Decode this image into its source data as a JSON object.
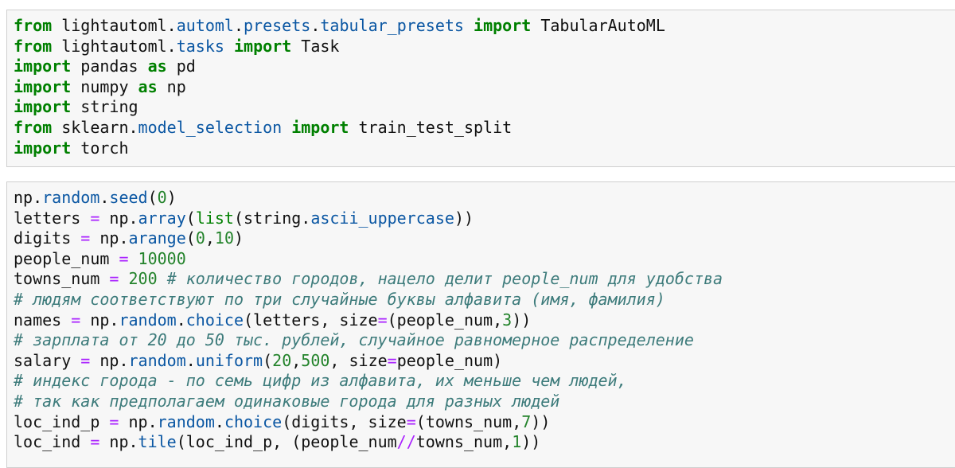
{
  "cells": [
    {
      "lines": [
        [
          [
            "kw",
            "from"
          ],
          [
            "plain",
            " lightautoml."
          ],
          [
            "attr",
            "automl"
          ],
          [
            "plain",
            "."
          ],
          [
            "attr",
            "presets"
          ],
          [
            "plain",
            "."
          ],
          [
            "attr",
            "tabular_presets"
          ],
          [
            "plain",
            " "
          ],
          [
            "kw",
            "import"
          ],
          [
            "plain",
            " TabularAutoML"
          ]
        ],
        [
          [
            "kw",
            "from"
          ],
          [
            "plain",
            " lightautoml."
          ],
          [
            "attr",
            "tasks"
          ],
          [
            "plain",
            " "
          ],
          [
            "kw",
            "import"
          ],
          [
            "plain",
            " Task"
          ]
        ],
        [
          [
            "kw",
            "import"
          ],
          [
            "plain",
            " pandas "
          ],
          [
            "kw",
            "as"
          ],
          [
            "plain",
            " pd"
          ]
        ],
        [
          [
            "kw",
            "import"
          ],
          [
            "plain",
            " numpy "
          ],
          [
            "kw",
            "as"
          ],
          [
            "plain",
            " np"
          ]
        ],
        [
          [
            "kw",
            "import"
          ],
          [
            "plain",
            " string"
          ]
        ],
        [
          [
            "kw",
            "from"
          ],
          [
            "plain",
            " sklearn."
          ],
          [
            "attr",
            "model_selection"
          ],
          [
            "plain",
            " "
          ],
          [
            "kw",
            "import"
          ],
          [
            "plain",
            " train_test_split"
          ]
        ],
        [
          [
            "kw",
            "import"
          ],
          [
            "plain",
            " torch"
          ]
        ]
      ]
    },
    {
      "lines": [
        [
          [
            "plain",
            "np."
          ],
          [
            "attr",
            "random"
          ],
          [
            "plain",
            "."
          ],
          [
            "attr",
            "seed"
          ],
          [
            "plain",
            "("
          ],
          [
            "num",
            "0"
          ],
          [
            "plain",
            ")"
          ]
        ],
        [
          [
            "plain",
            "letters "
          ],
          [
            "op",
            "="
          ],
          [
            "plain",
            " np."
          ],
          [
            "attr",
            "array"
          ],
          [
            "plain",
            "("
          ],
          [
            "builtin",
            "list"
          ],
          [
            "plain",
            "(string."
          ],
          [
            "attr",
            "ascii_uppercase"
          ],
          [
            "plain",
            "))"
          ]
        ],
        [
          [
            "plain",
            "digits "
          ],
          [
            "op",
            "="
          ],
          [
            "plain",
            " np."
          ],
          [
            "attr",
            "arange"
          ],
          [
            "plain",
            "("
          ],
          [
            "num",
            "0"
          ],
          [
            "plain",
            ","
          ],
          [
            "num",
            "10"
          ],
          [
            "plain",
            ")"
          ]
        ],
        [
          [
            "plain",
            "people_num "
          ],
          [
            "op",
            "="
          ],
          [
            "plain",
            " "
          ],
          [
            "num",
            "10000"
          ]
        ],
        [
          [
            "plain",
            "towns_num "
          ],
          [
            "op",
            "="
          ],
          [
            "plain",
            " "
          ],
          [
            "num",
            "200"
          ],
          [
            "plain",
            " "
          ],
          [
            "com",
            "# количество городов, нацело делит people_num для удобства"
          ]
        ],
        [
          [
            "com",
            "# людям соответствуют по три случайные буквы алфавита (имя, фамилия)"
          ]
        ],
        [
          [
            "plain",
            "names "
          ],
          [
            "op",
            "="
          ],
          [
            "plain",
            " np."
          ],
          [
            "attr",
            "random"
          ],
          [
            "plain",
            "."
          ],
          [
            "attr",
            "choice"
          ],
          [
            "plain",
            "(letters, size"
          ],
          [
            "op",
            "="
          ],
          [
            "plain",
            "(people_num,"
          ],
          [
            "num",
            "3"
          ],
          [
            "plain",
            "))"
          ]
        ],
        [
          [
            "com",
            "# зарплата от 20 до 50 тыс. рублей, случайное равномерное распределение"
          ]
        ],
        [
          [
            "plain",
            "salary "
          ],
          [
            "op",
            "="
          ],
          [
            "plain",
            " np."
          ],
          [
            "attr",
            "random"
          ],
          [
            "plain",
            "."
          ],
          [
            "attr",
            "uniform"
          ],
          [
            "plain",
            "("
          ],
          [
            "num",
            "20"
          ],
          [
            "plain",
            ","
          ],
          [
            "num",
            "500"
          ],
          [
            "plain",
            ", size"
          ],
          [
            "op",
            "="
          ],
          [
            "plain",
            "people_num)"
          ]
        ],
        [
          [
            "com",
            "# индекс города - по семь цифр из алфавита, их меньше чем людей,"
          ]
        ],
        [
          [
            "com",
            "# так как предполагаем одинаковые города для разных людей"
          ]
        ],
        [
          [
            "plain",
            "loc_ind_p "
          ],
          [
            "op",
            "="
          ],
          [
            "plain",
            " np."
          ],
          [
            "attr",
            "random"
          ],
          [
            "plain",
            "."
          ],
          [
            "attr",
            "choice"
          ],
          [
            "plain",
            "(digits, size"
          ],
          [
            "op",
            "="
          ],
          [
            "plain",
            "(towns_num,"
          ],
          [
            "num",
            "7"
          ],
          [
            "plain",
            "))"
          ]
        ],
        [
          [
            "plain",
            "loc_ind "
          ],
          [
            "op",
            "="
          ],
          [
            "plain",
            " np."
          ],
          [
            "attr",
            "tile"
          ],
          [
            "plain",
            "(loc_ind_p, (people_num"
          ],
          [
            "op",
            "//"
          ],
          [
            "plain",
            "towns_num,"
          ],
          [
            "num",
            "1"
          ],
          [
            "plain",
            "))"
          ]
        ]
      ]
    }
  ]
}
